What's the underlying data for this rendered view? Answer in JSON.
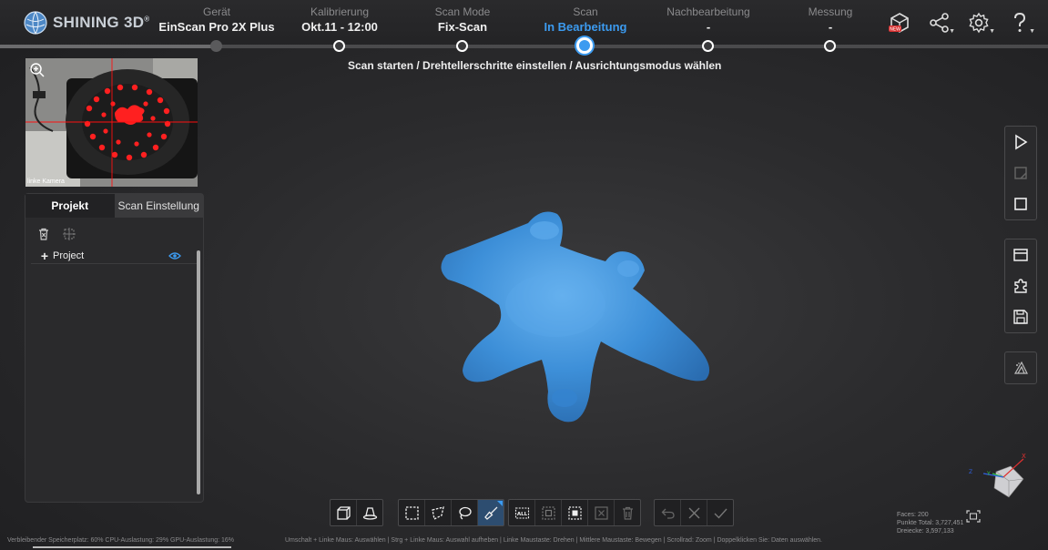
{
  "app": {
    "brand": "SHINING 3D",
    "brand_mark": "®"
  },
  "steps": [
    {
      "label": "Gerät",
      "value": "EinScan Pro 2X Plus"
    },
    {
      "label": "Kalibrierung",
      "value": "Okt.11 - 12:00"
    },
    {
      "label": "Scan Mode",
      "value": "Fix-Scan"
    },
    {
      "label": "Scan",
      "value": "In Bearbeitung"
    },
    {
      "label": "Nachbearbeitung",
      "value": "-"
    },
    {
      "label": "Messung",
      "value": "-"
    }
  ],
  "active_step": 3,
  "top_icons": [
    "new-feature-icon",
    "share-icon",
    "settings-icon",
    "help-icon"
  ],
  "new_badge": "NEW",
  "breadcrumb": "Scan starten / Drehtellerschritte einstellen / Ausrichtungsmodus wählen",
  "camera": {
    "label": "linke Kamera"
  },
  "panel": {
    "tabs": [
      "Projekt",
      "Scan Einstellung"
    ],
    "active_tab": 0,
    "tree": [
      {
        "label": "Project",
        "visible": true
      }
    ]
  },
  "right_toolbar": {
    "group1": [
      "play-icon",
      "scan-range-icon",
      "stop-icon"
    ],
    "group2": [
      "window-icon",
      "puzzle-icon",
      "save-icon"
    ],
    "group3": [
      "mesh-icon"
    ]
  },
  "bottom_toolbar": {
    "view": [
      "view-box-icon",
      "turntable-icon"
    ],
    "select": [
      "rect-select-icon",
      "polygon-select-icon",
      "lasso-select-icon",
      "brush-select-icon"
    ],
    "select_active": 3,
    "edit": [
      "select-all-icon",
      "invert-select-icon",
      "select-connected-icon",
      "delete-selection-icon",
      "trash-icon"
    ],
    "confirm": [
      "undo-icon",
      "cancel-icon",
      "apply-icon"
    ],
    "select_all_label": "ALL"
  },
  "status": {
    "resources": "Verbleibender Speicherplatz: 60%  CPU-Auslastung: 29%  GPU-Auslastung: 16%",
    "hints": "Umschalt + Linke Maus: Auswählen | Strg + Linke Maus: Auswahl aufheben | Linke Maustaste: Drehen | Mittlere Maustaste: Bewegen | Scrollrad: Zoom | Doppelklicken Sie: Daten auswählen."
  },
  "stats": {
    "faces": "Faces: 200",
    "points": "Punkte Total: 3,727,451",
    "triangles": "Dreiecke: 3,597,133"
  },
  "axes": {
    "x": "X",
    "y": "Y",
    "z": "Z"
  },
  "colors": {
    "accent": "#3c9bf0",
    "scan": "#3d8fd8",
    "axis_x": "#e03030",
    "axis_y": "#30c040",
    "axis_z": "#3060e0"
  }
}
